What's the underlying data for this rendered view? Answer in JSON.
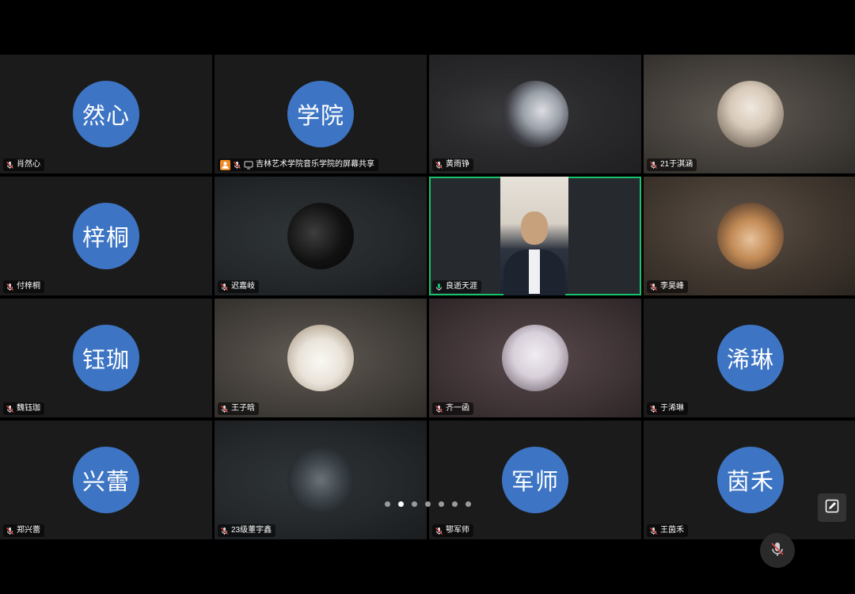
{
  "participants": [
    {
      "name": "肖然心",
      "avatar_text": "然心",
      "avatar_type": "text"
    },
    {
      "name": "吉林艺术学院音乐学院的屏幕共享",
      "avatar_text": "学院",
      "avatar_type": "text",
      "screen_share": true
    },
    {
      "name": "黄雨铮",
      "avatar_type": "photo",
      "photo_icon": "portrait-photo"
    },
    {
      "name": "21于淇涵",
      "avatar_type": "photo",
      "photo_icon": "portrait-photo"
    },
    {
      "name": "付梓桐",
      "avatar_text": "梓桐",
      "avatar_type": "text"
    },
    {
      "name": "迟嘉岐",
      "avatar_type": "photo",
      "photo_icon": "portrait-photo"
    },
    {
      "name": "良逝天涯",
      "avatar_type": "video",
      "active_speaker": true
    },
    {
      "name": "李昊峰",
      "avatar_type": "photo",
      "photo_icon": "dog-photo"
    },
    {
      "name": "魏钰珈",
      "avatar_text": "钰珈",
      "avatar_type": "text"
    },
    {
      "name": "王子晗",
      "avatar_type": "photo",
      "photo_icon": "cat-photo"
    },
    {
      "name": "齐一函",
      "avatar_type": "photo",
      "photo_icon": "portrait-photo"
    },
    {
      "name": "于浠琳",
      "avatar_text": "浠琳",
      "avatar_type": "text"
    },
    {
      "name": "郑兴蕾",
      "avatar_text": "兴蕾",
      "avatar_type": "text"
    },
    {
      "name": "23级董宇鑫",
      "avatar_type": "photo",
      "photo_icon": "soldier-photo"
    },
    {
      "name": "鄂军师",
      "avatar_text": "军师",
      "avatar_type": "text"
    },
    {
      "name": "王茵禾",
      "avatar_text": "茵禾",
      "avatar_type": "text"
    }
  ],
  "pager": {
    "total_pages": 7,
    "current_page": 2
  },
  "colors": {
    "avatar_bg": "#3d75c4",
    "active_border": "#16c36b",
    "share_badge": "#f08a24"
  },
  "controls": {
    "edit_icon": "edit-icon",
    "mic_icon": "mic-muted-icon"
  }
}
